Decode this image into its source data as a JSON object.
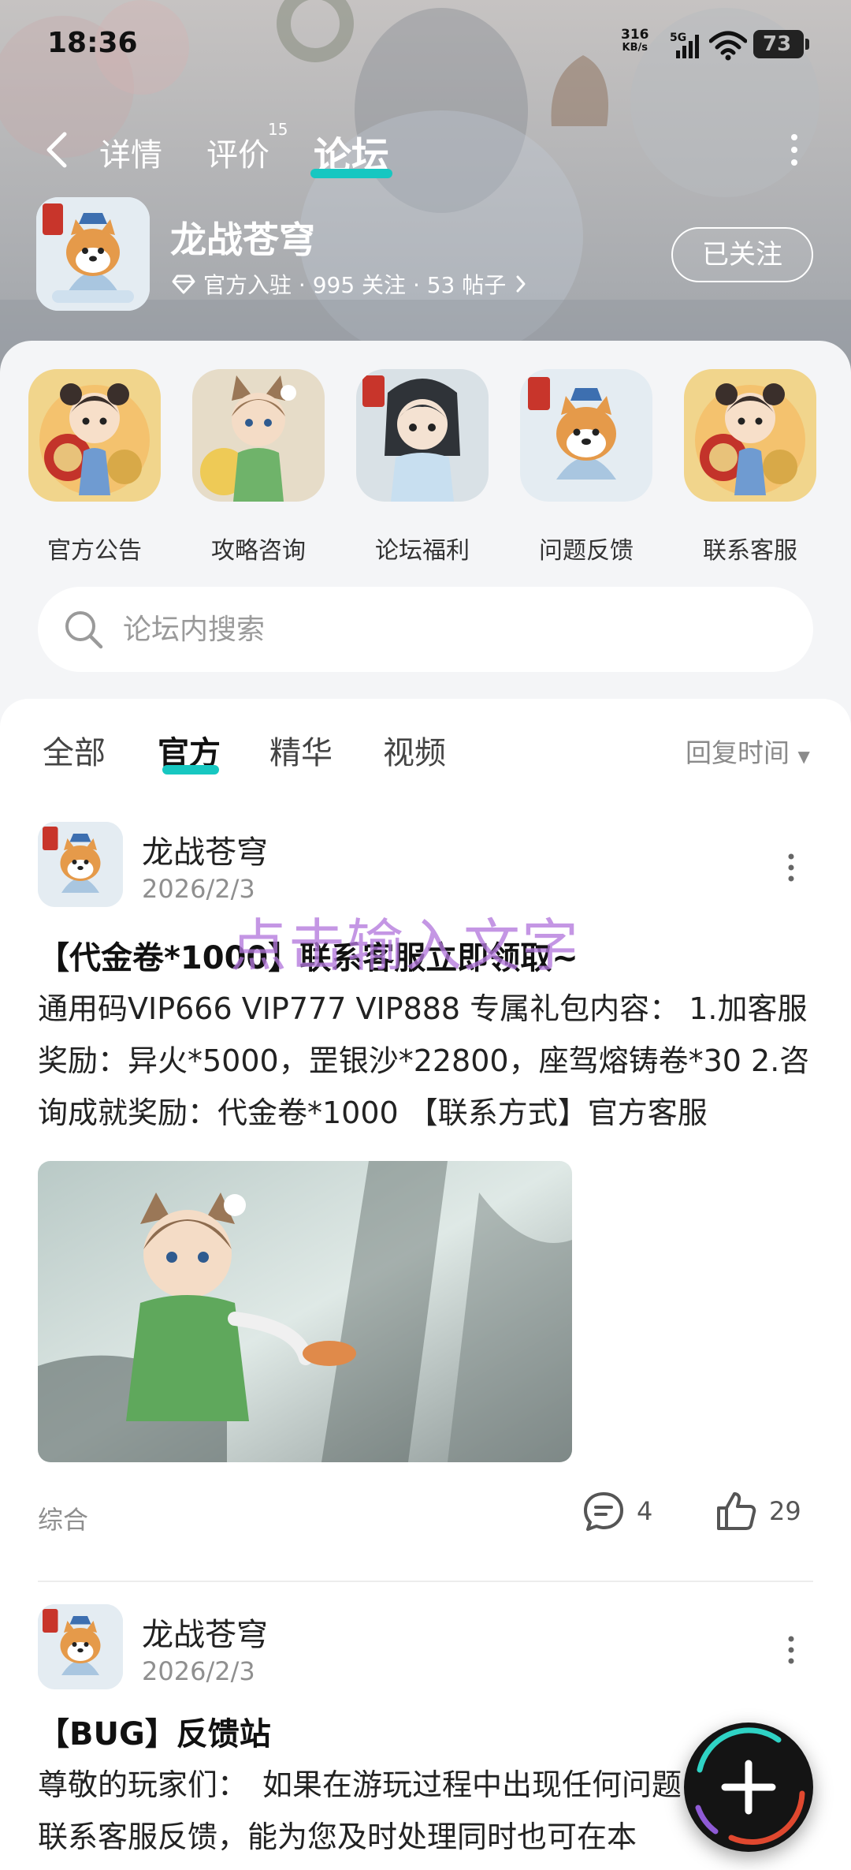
{
  "status_bar": {
    "time": "18:36",
    "net_speed_value": "316",
    "net_speed_unit": "KB/s",
    "network": "5G",
    "battery": "73"
  },
  "nav": {
    "tabs": [
      {
        "label": "详情"
      },
      {
        "label": "评价",
        "badge": "15"
      },
      {
        "label": "论坛"
      }
    ],
    "active_tab": "论坛",
    "accent_color": "#17c7c1"
  },
  "game": {
    "name": "龙战苍穹",
    "meta": "官方入驻 · 995 关注 · 53 帖子",
    "follow_label": "已关注"
  },
  "shortcuts": [
    {
      "label": "官方公告",
      "icon": "girl-drum-icon"
    },
    {
      "label": "攻略咨询",
      "icon": "fox-girl-icon"
    },
    {
      "label": "论坛福利",
      "icon": "boy-character-icon"
    },
    {
      "label": "问题反馈",
      "icon": "shiba-scholar-icon"
    },
    {
      "label": "联系客服",
      "icon": "girl-drum-icon"
    }
  ],
  "search": {
    "placeholder": "论坛内搜索"
  },
  "filter": {
    "tabs": [
      {
        "label": "全部"
      },
      {
        "label": "官方"
      },
      {
        "label": "精华"
      },
      {
        "label": "视频"
      }
    ],
    "active": "官方",
    "sort_label": "回复时间"
  },
  "overlay_text": "点击输入文字",
  "posts": [
    {
      "author": "龙战苍穹",
      "date": "2026/2/3",
      "title": "【代金卷*1000】联系客服立即领取~",
      "body": "通用码VIP666 VIP777 VIP888 专属礼包内容： 1.加客服奖励：异火*5000，罡银沙*22800，座驾熔铸卷*30 2.咨询成就奖励：代金卷*1000 【联系方式】官方客服",
      "tag": "综合",
      "comments": "4",
      "likes": "29"
    },
    {
      "author": "龙战苍穹",
      "date": "2026/2/3",
      "title": "【BUG】反馈站",
      "body": "尊敬的玩家们：　如果在游玩过程中出现任何问题，都建议联系客服反馈，能为您及时处理同时也可在本"
    }
  ]
}
